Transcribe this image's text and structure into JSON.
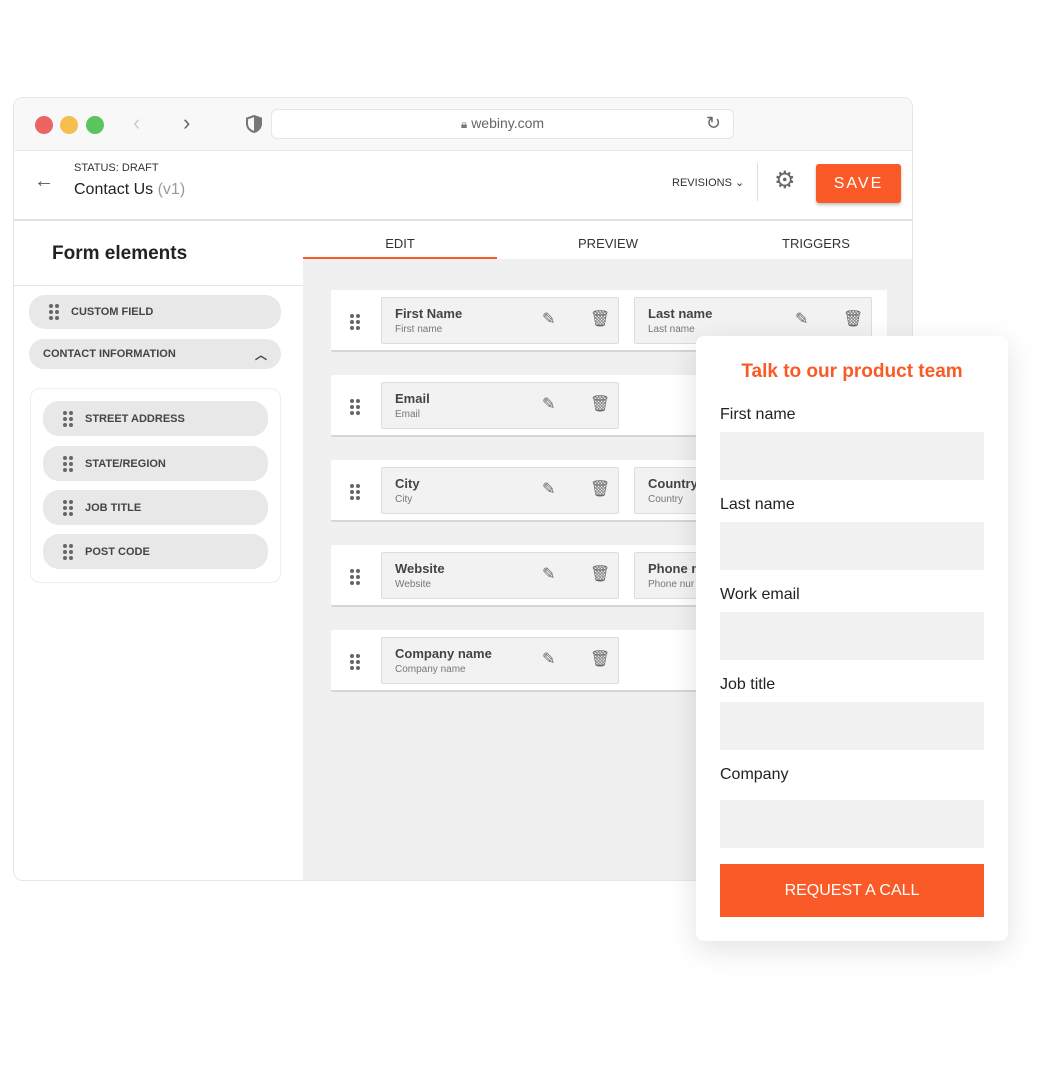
{
  "browser": {
    "url": "webiny.com",
    "traffic_lights": [
      "#ec6464",
      "#f5be50",
      "#5cc45c"
    ]
  },
  "header": {
    "status": "STATUS: DRAFT",
    "title": "Contact Us",
    "version": "(v1)",
    "revisions_label": "REVISIONS",
    "save_label": "SAVE"
  },
  "accent": "#fa5a28",
  "sidebar": {
    "title": "Form elements",
    "custom_field": "CUSTOM FIELD",
    "group_label": "CONTACT INFORMATION",
    "items": [
      "STREET ADDRESS",
      "STATE/REGION",
      "JOB TITLE",
      "POST CODE"
    ]
  },
  "tabs": [
    "EDIT",
    "PREVIEW",
    "TRIGGERS"
  ],
  "rows": [
    [
      {
        "label": "First Name",
        "placeholder": "First name"
      },
      {
        "label": "Last name",
        "placeholder": "Last name"
      }
    ],
    [
      {
        "label": "Email",
        "placeholder": "Email"
      }
    ],
    [
      {
        "label": "City",
        "placeholder": "City"
      },
      {
        "label": "Country",
        "placeholder": "Country"
      }
    ],
    [
      {
        "label": "Website",
        "placeholder": "Website"
      },
      {
        "label": "Phone n",
        "placeholder": "Phone nur"
      }
    ],
    [
      {
        "label": "Company name",
        "placeholder": "Company name"
      }
    ]
  ],
  "preview": {
    "title": "Talk to our product team",
    "fields": [
      "First name",
      "Last name",
      "Work email",
      "Job title",
      "Company"
    ],
    "button": "REQUEST A CALL"
  }
}
